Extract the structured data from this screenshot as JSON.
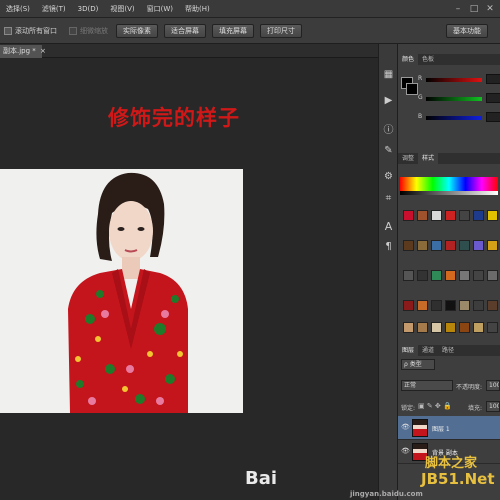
{
  "menubar": {
    "items": [
      "文件(F)",
      "编辑(E)",
      "图像(I)",
      "图层(L)",
      "选择(S)",
      "滤镜(T)",
      "3D(D)",
      "视图(V)",
      "窗口(W)",
      "帮助(H)"
    ],
    "visible_items": [
      "选择(S)",
      "滤镜(T)",
      "3D(D)",
      "视图(V)",
      "窗口(W)",
      "帮助(H)"
    ]
  },
  "optionsbar": {
    "scroll_all": "滚动所有窗口",
    "scrubby_zoom": "细微缩放",
    "buttons": [
      "实际像素",
      "适合屏幕",
      "填充屏幕",
      "打印尺寸"
    ],
    "workspace": "基本功能"
  },
  "document": {
    "tab_label": "副本.jpg *",
    "headline": "修饰完的样子"
  },
  "panels": {
    "color_tabs": [
      "颜色",
      "色板"
    ],
    "style_tabs": [
      "调整",
      "样式"
    ],
    "layers_tabs": [
      "图层",
      "通道",
      "路径"
    ],
    "rgb_labels": [
      "R",
      "G",
      "B"
    ],
    "filter_kind": "类型",
    "blend_mode": "正常",
    "opacity_label": "不透明度:",
    "opacity_value": "100%",
    "lock_label": "锁定:",
    "fill_label": "填充:",
    "fill_value": "100%",
    "layers": [
      {
        "name": "图层 1",
        "selected": true
      },
      {
        "name": "背景 副本",
        "selected": false
      }
    ]
  },
  "watermark": {
    "baidu": "Bai",
    "site1": "脚本之家",
    "site2": "JB51.Net",
    "url": "jingyan.baidu.com"
  },
  "colors": {
    "headline": "#d01818",
    "selected_layer": "#526e93"
  }
}
